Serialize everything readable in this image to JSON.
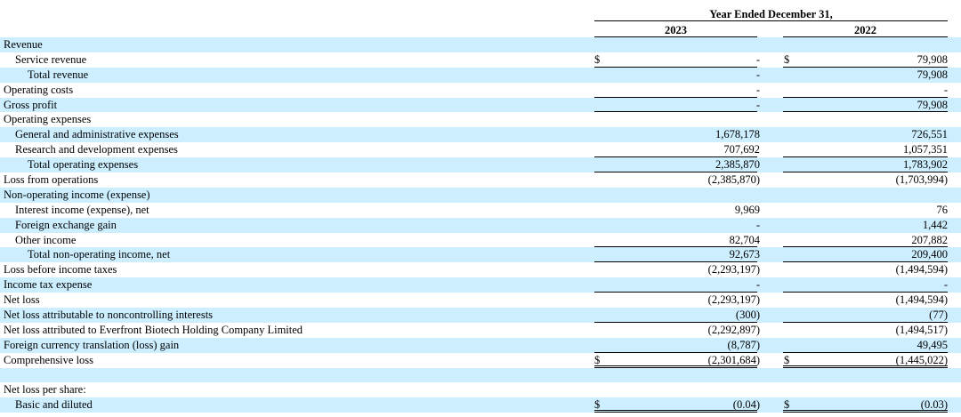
{
  "header": {
    "title": "Year Ended December 31,",
    "col1": "2023",
    "col2": "2022"
  },
  "rows": [
    {
      "label": "Revenue",
      "indent": 0,
      "v1": "",
      "v2": "",
      "shade": true
    },
    {
      "label": "Service revenue",
      "indent": 1,
      "cur1": "$",
      "v1": "-",
      "cur2": "$",
      "v2": "79,908",
      "shade": false,
      "rule": "single"
    },
    {
      "label": "Total revenue",
      "indent": 2,
      "v1": "-",
      "v2": "79,908",
      "shade": true
    },
    {
      "label": "Operating costs",
      "indent": 0,
      "v1": "-",
      "v2": "-",
      "shade": false,
      "rule": "single"
    },
    {
      "label": "Gross profit",
      "indent": 0,
      "v1": "-",
      "v2": "79,908",
      "shade": true,
      "rule": "single"
    },
    {
      "label": "Operating expenses",
      "indent": 0,
      "v1": "",
      "v2": "",
      "shade": false
    },
    {
      "label": "General and administrative expenses",
      "indent": 1,
      "v1": "1,678,178",
      "v2": "726,551",
      "shade": true
    },
    {
      "label": "Research and development expenses",
      "indent": 1,
      "v1": "707,692",
      "v2": "1,057,351",
      "shade": false,
      "rule": "single"
    },
    {
      "label": "Total operating expenses",
      "indent": 2,
      "v1": "2,385,870",
      "v2": "1,783,902",
      "shade": true,
      "rule": "single"
    },
    {
      "label": "Loss from operations",
      "indent": 0,
      "v1": "(2,385,870)",
      "v2": "(1,703,994)",
      "shade": false
    },
    {
      "label": "Non-operating income (expense)",
      "indent": 0,
      "v1": "",
      "v2": "",
      "shade": true
    },
    {
      "label": "Interest income (expense), net",
      "indent": 1,
      "v1": "9,969",
      "v2": "76",
      "shade": false
    },
    {
      "label": "Foreign exchange gain",
      "indent": 1,
      "v1": "-",
      "v2": "1,442",
      "shade": true
    },
    {
      "label": "Other income",
      "indent": 1,
      "v1": "82,704",
      "v2": "207,882",
      "shade": false,
      "rule": "single"
    },
    {
      "label": "Total non-operating income, net",
      "indent": 2,
      "v1": "92,673",
      "v2": "209,400",
      "shade": true,
      "rule": "single"
    },
    {
      "label": "Loss before income taxes",
      "indent": 0,
      "v1": "(2,293,197)",
      "v2": "(1,494,594)",
      "shade": false
    },
    {
      "label": "Income tax expense",
      "indent": 0,
      "v1": "-",
      "v2": "-",
      "shade": true,
      "rule": "single"
    },
    {
      "label": "Net loss",
      "indent": 0,
      "v1": "(2,293,197)",
      "v2": "(1,494,594)",
      "shade": false
    },
    {
      "label": "Net loss attributable to noncontrolling interests",
      "indent": 0,
      "v1": "(300)",
      "v2": "(77)",
      "shade": true,
      "rule": "single"
    },
    {
      "label": "Net loss attributed to Everfront Biotech Holding Company Limited",
      "indent": 0,
      "v1": "(2,292,897)",
      "v2": "(1,494,517)",
      "shade": false
    },
    {
      "label": "Foreign currency translation (loss) gain",
      "indent": 0,
      "v1": "(8,787)",
      "v2": "49,495",
      "shade": true,
      "rule": "single"
    },
    {
      "label": "Comprehensive loss",
      "indent": 0,
      "cur1": "$",
      "v1": "(2,301,684)",
      "cur2": "$",
      "v2": "(1,445,022)",
      "shade": false,
      "rule": "double"
    },
    {
      "label": "",
      "indent": 0,
      "v1": "",
      "v2": "",
      "shade": true
    },
    {
      "label": "Net loss per share:",
      "indent": 0,
      "v1": "",
      "v2": "",
      "shade": false
    },
    {
      "label": "Basic and diluted",
      "indent": 1,
      "cur1": "$",
      "v1": "(0.04)",
      "cur2": "$",
      "v2": "(0.03)",
      "shade": true,
      "rule": "double"
    }
  ]
}
